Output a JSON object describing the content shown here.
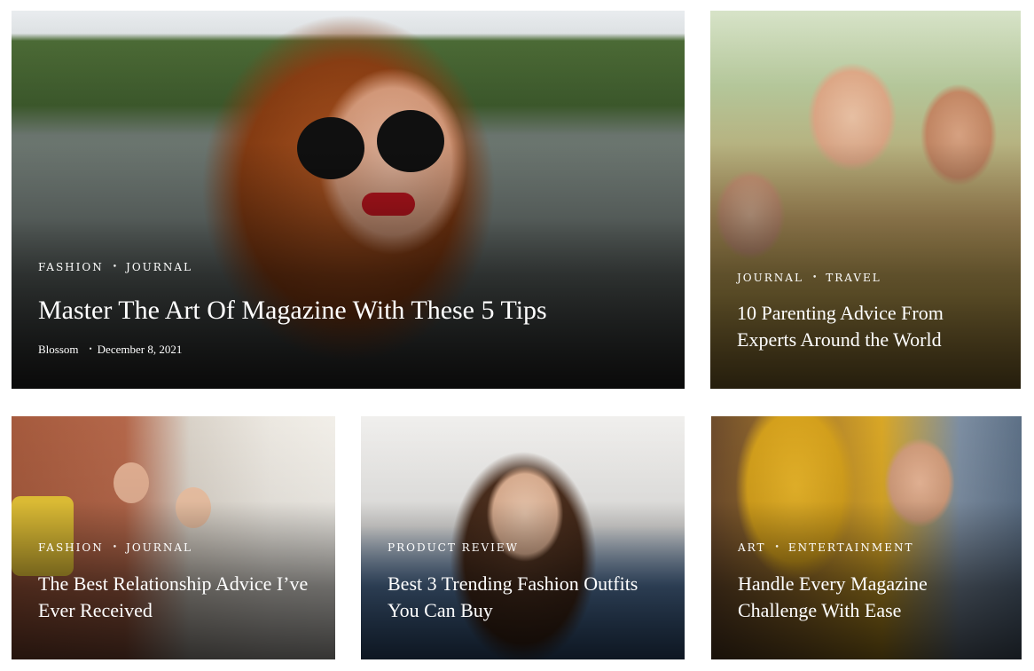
{
  "cards": [
    {
      "categories": [
        "Fashion",
        "Journal"
      ],
      "title": "Master The Art Of Magazine With These 5 Tips",
      "author": "Blossom",
      "date": "December 8, 2021"
    },
    {
      "categories": [
        "Journal",
        "Travel"
      ],
      "title": "10 Parenting Advice From Experts Around the World"
    },
    {
      "categories": [
        "Fashion",
        "Journal"
      ],
      "title": "The Best Relationship Advice I’ve Ever Received"
    },
    {
      "categories": [
        "Product Review"
      ],
      "title": "Best 3 Trending Fashion Outfits You Can Buy"
    },
    {
      "categories": [
        "Art",
        "Entertainment"
      ],
      "title": "Handle Every Magazine Challenge With Ease"
    }
  ]
}
